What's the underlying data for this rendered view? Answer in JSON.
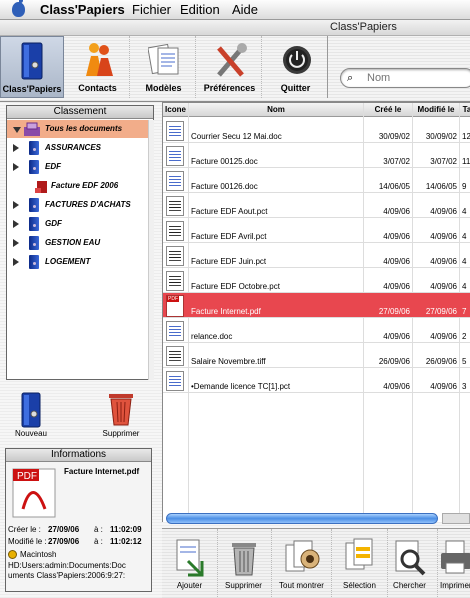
{
  "menubar": {
    "app": "Class'Papiers",
    "items": [
      "Fichier",
      "Edition",
      "Aide"
    ]
  },
  "window": {
    "title": "Class'Papiers"
  },
  "toolbar": {
    "buttons": [
      {
        "label": "Class'Papiers",
        "icon": "binder-icon"
      },
      {
        "label": "Contacts",
        "icon": "people-icon"
      },
      {
        "label": "Modèles",
        "icon": "templates-icon"
      },
      {
        "label": "Préférences",
        "icon": "tools-icon"
      },
      {
        "label": "Quitter",
        "icon": "power-icon"
      }
    ]
  },
  "search": {
    "placeholder": "Nom"
  },
  "sidebar": {
    "title": "Classement",
    "items": [
      {
        "label": "Tous les documents",
        "expanded": true,
        "selected": true
      },
      {
        "label": "ASSURANCES"
      },
      {
        "label": "EDF"
      },
      {
        "label": "Facture EDF 2006",
        "child": true
      },
      {
        "label": "FACTURES D'ACHATS"
      },
      {
        "label": "GDF"
      },
      {
        "label": "GESTION EAU"
      },
      {
        "label": "LOGEMENT"
      }
    ]
  },
  "actions": {
    "new_label": "Nouveau",
    "delete_label": "Supprimer"
  },
  "info": {
    "title": "Informations",
    "filename": "Facture Internet.pdf",
    "created_label": "Créer le :",
    "created_date": "27/09/06",
    "created_at": "à :",
    "created_time": "11:02:09",
    "modified_label": "Modifié le :",
    "modified_date": "27/09/06",
    "modified_at": "à :",
    "modified_time": "11:02:12",
    "volume": "Macintosh",
    "path1": "HD:Users:admin:Documents:Doc",
    "path2": "uments Class'Papiers:2006:9:27:"
  },
  "table": {
    "columns": [
      "Icone",
      "Nom",
      "Créé le",
      "Modifié le",
      "Ta"
    ],
    "rows": [
      {
        "type": "doc",
        "name": "Courrier Secu 12 Mai.doc",
        "created": "30/09/02",
        "modified": "30/09/02",
        "size": "12"
      },
      {
        "type": "doc",
        "name": "Facture 00125.doc",
        "created": "3/07/02",
        "modified": "3/07/02",
        "size": "11"
      },
      {
        "type": "doc",
        "name": "Facture 00126.doc",
        "created": "14/06/05",
        "modified": "14/06/05",
        "size": "9"
      },
      {
        "type": "pct",
        "name": "Facture EDF Aout.pct",
        "created": "4/09/06",
        "modified": "4/09/06",
        "size": "4"
      },
      {
        "type": "pct",
        "name": "Facture EDF Avril.pct",
        "created": "4/09/06",
        "modified": "4/09/06",
        "size": "4"
      },
      {
        "type": "pct",
        "name": "Facture EDF Juin.pct",
        "created": "4/09/06",
        "modified": "4/09/06",
        "size": "4"
      },
      {
        "type": "pct",
        "name": "Facture EDF Octobre.pct",
        "created": "4/09/06",
        "modified": "4/09/06",
        "size": "4"
      },
      {
        "type": "pdf",
        "name": "Facture Internet.pdf",
        "created": "27/09/06",
        "modified": "27/09/06",
        "size": "7",
        "selected": true
      },
      {
        "type": "doc",
        "name": "relance.doc",
        "created": "4/09/06",
        "modified": "4/09/06",
        "size": "2"
      },
      {
        "type": "pct",
        "name": "Salaire Novembre.tiff",
        "created": "26/09/06",
        "modified": "26/09/06",
        "size": "5"
      },
      {
        "type": "doc",
        "name": "•Demande licence TC[1].pct",
        "created": "4/09/06",
        "modified": "4/09/06",
        "size": "3"
      }
    ]
  },
  "bottombar": {
    "buttons": [
      "Ajouter",
      "Supprimer",
      "Tout montrer",
      "Sélection",
      "Chercher",
      "Imprimer"
    ]
  }
}
